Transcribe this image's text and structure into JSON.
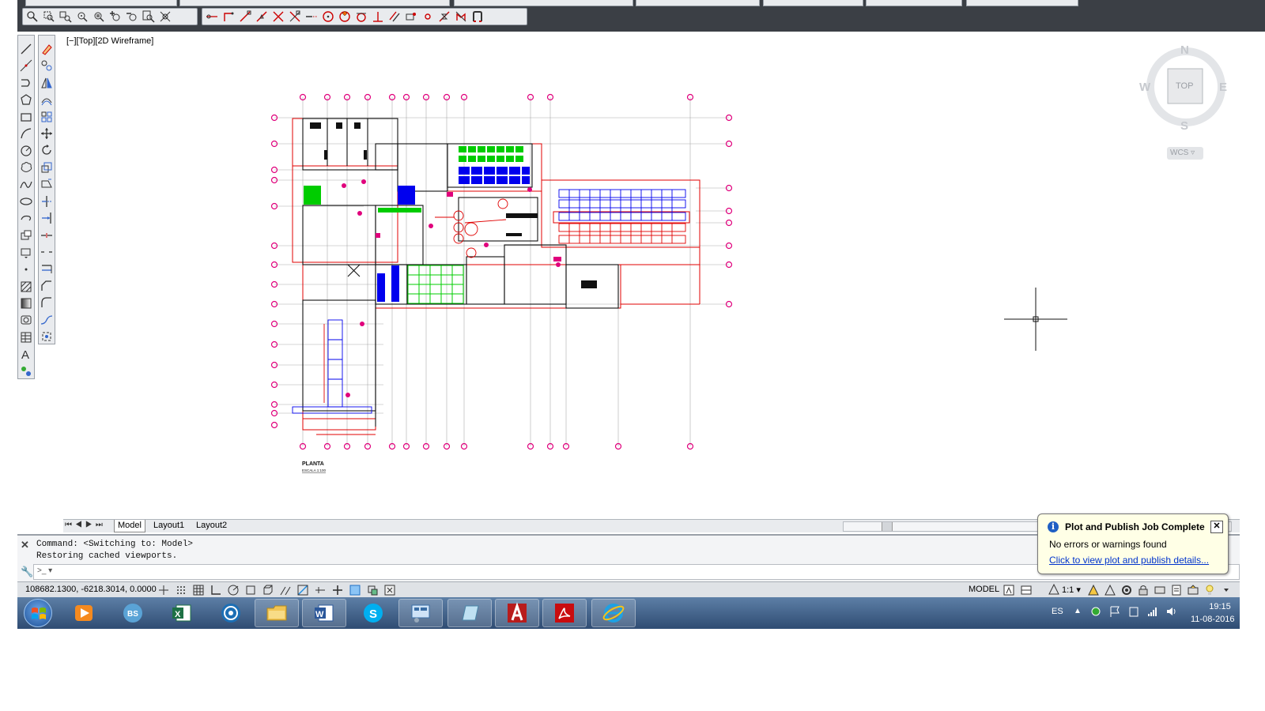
{
  "viewport": {
    "label": "[−][Top][2D Wireframe]"
  },
  "viewcube": {
    "north": "N",
    "south": "S",
    "east": "E",
    "west": "W",
    "top_face": "TOP",
    "wcs": "WCS ▿"
  },
  "drawing": {
    "title": "PLANTA",
    "scale": "ESCALA 1:100"
  },
  "layout_tabs": {
    "model": "Model",
    "layout1": "Layout1",
    "layout2": "Layout2"
  },
  "command_window": {
    "line1": "Command:   <Switching to: Model>",
    "line2": "Restoring cached viewports.",
    "prompt": ">_ ▾"
  },
  "status_bar": {
    "coordinates": "108682.1300, -6218.3014, 0.0000",
    "space": "MODEL",
    "annotation_scale": "1:1 ▾"
  },
  "notification": {
    "title": "Plot and Publish Job Complete",
    "message": "No errors or warnings found",
    "link": "Click to view plot and publish details..."
  },
  "taskbar": {
    "language": "ES",
    "time": "19:15",
    "date": "11-08-2016"
  },
  "colors": {
    "toolbar_bg": "#3b3f45",
    "drawing_red": "#e00000",
    "drawing_magenta": "#e0007c",
    "drawing_blue": "#0000ee",
    "drawing_green": "#00cc00",
    "taskbar": "#2f4c73"
  }
}
